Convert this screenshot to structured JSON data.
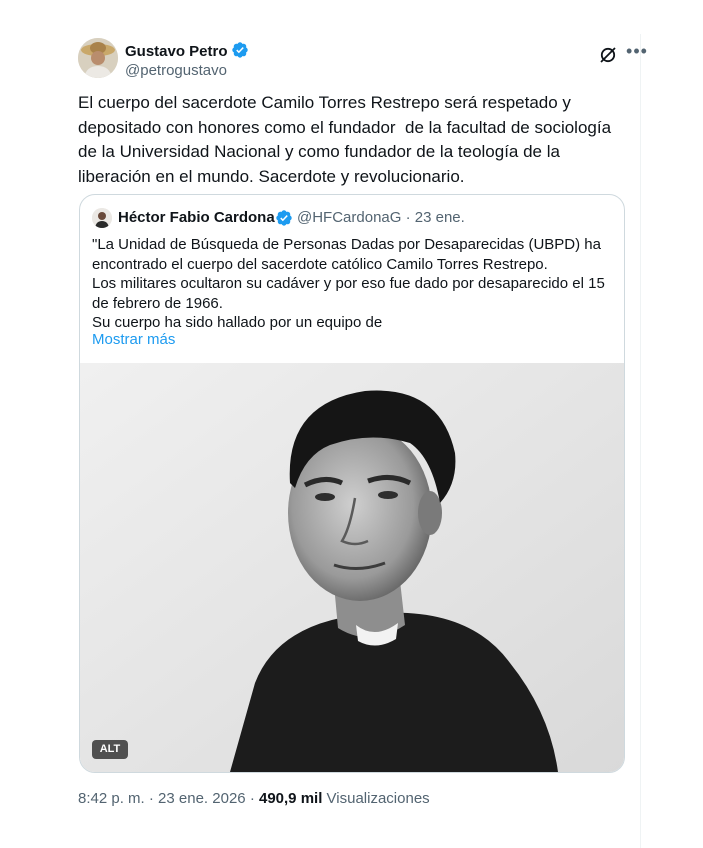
{
  "post": {
    "author": {
      "name": "Gustavo Petro",
      "handle": "@petrogustavo"
    },
    "text": "El cuerpo del sacerdote Camilo Torres Restrepo será respetado y\ndepositado con honores como el fundador  de la facultad de sociología\nde la Universidad Nacional y como fundador de la teología de la\nliberación en el mundo. Sacerdote y revolucionario.",
    "time": "8:42 p. m.",
    "date": "23 ene. 2026",
    "separator": "·",
    "views_count": "490,9 mil",
    "views_label": "Visualizaciones"
  },
  "quote": {
    "author": {
      "name": "Héctor Fabio Cardona",
      "handle": "@HFCardonaG",
      "date": "· 23 ene."
    },
    "text_lines": [
      "\"La Unidad de Búsqueda de Personas Dadas por Desaparecidas (UBPD) ha",
      "encontrado el cuerpo del sacerdote católico Camilo Torres Restrepo.",
      "Los militares ocultaron su cadáver y por eso fue dado por desaparecido el 15",
      "de febrero de 1966.",
      "Su cuerpo ha sido hallado por un equipo de"
    ],
    "show_more": "Mostrar más",
    "alt_badge": "ALT"
  },
  "colors": {
    "text": "#0f1419",
    "secondary": "#536471",
    "link": "#1d9bf0",
    "border": "#cfd9de"
  }
}
